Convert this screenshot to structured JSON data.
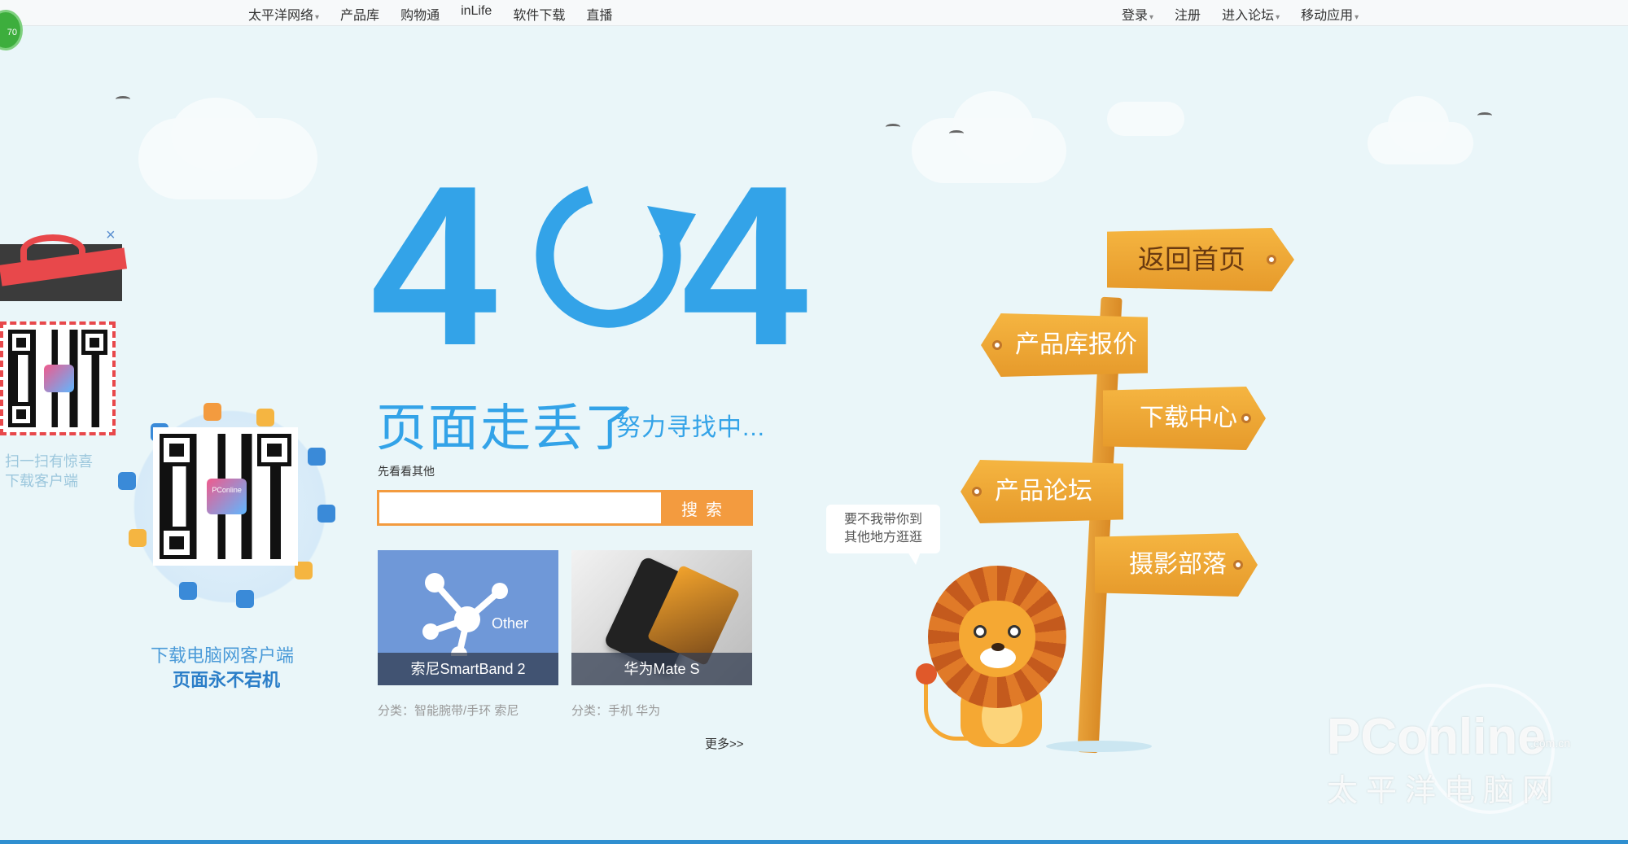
{
  "topbar": {
    "left_links": [
      {
        "label": "太平洋网络",
        "has_caret": true
      },
      {
        "label": "产品库",
        "has_caret": false
      },
      {
        "label": "购物通",
        "has_caret": false
      },
      {
        "label": "inLife",
        "has_caret": false
      },
      {
        "label": "软件下载",
        "has_caret": false
      },
      {
        "label": "直播",
        "has_caret": false
      }
    ],
    "right_links": [
      {
        "label": "登录",
        "has_caret": true
      },
      {
        "label": "注册",
        "has_caret": false
      },
      {
        "label": "进入论坛",
        "has_caret": true
      },
      {
        "label": "移动应用",
        "has_caret": true
      }
    ],
    "caret_symbol": "▾",
    "badge_text": "70"
  },
  "gift_panel": {
    "close_symbol": "×",
    "caption_line1": "扫一扫有惊喜",
    "caption_line2": "下载客户端"
  },
  "client_promo": {
    "line1": "下载电脑网客户端",
    "line2": "页面永不宕机",
    "qr_logo_text": "PConline"
  },
  "error": {
    "code_left": "4",
    "code_right": "4",
    "title": "页面走丢了",
    "subtitle": "努力寻找中..."
  },
  "search": {
    "label": "先看看其他",
    "placeholder": "",
    "value": "",
    "button": "搜索"
  },
  "cards": [
    {
      "label": "索尼SmartBand 2",
      "badge": "Other",
      "tag": "分类：智能腕带/手环  索尼"
    },
    {
      "label": "华为Mate S",
      "tag": "分类：手机  华为"
    }
  ],
  "more_link": "更多>>",
  "signs": {
    "home": "返回首页",
    "price": "产品库报价",
    "download": "下载中心",
    "forum": "产品论坛",
    "photo": "摄影部落"
  },
  "speech_bubble": {
    "line1": "要不我带你到",
    "line2": "其他地方逛逛"
  },
  "watermark": {
    "brand": "PConline",
    "domain": ".com.cn",
    "cn": "太平洋电脑网"
  },
  "colors": {
    "accent_blue": "#33a3e8",
    "search_orange": "#f39b3f",
    "sign_orange": "#f5b541",
    "background": "#eaf6f9"
  }
}
